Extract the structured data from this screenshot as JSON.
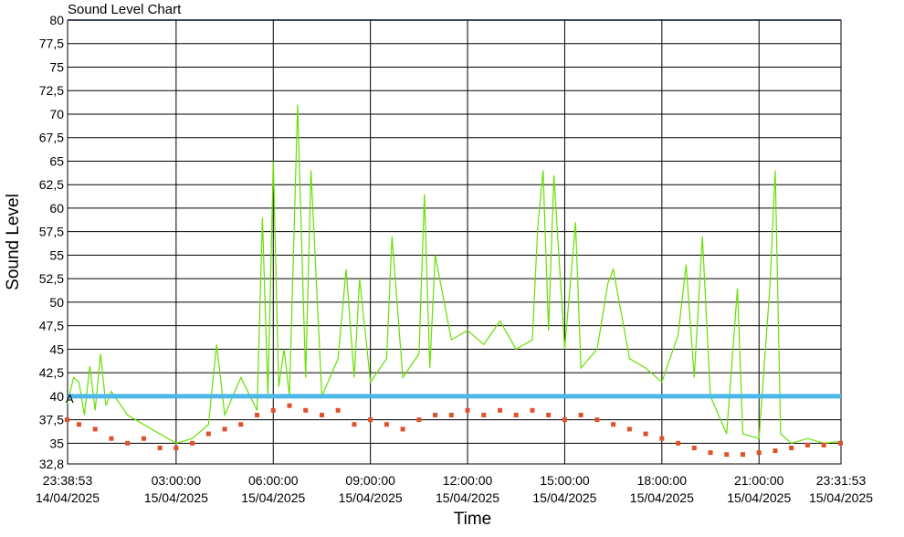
{
  "window": {
    "title": "Sound Level Chart"
  },
  "chart_data": {
    "type": "line",
    "title": "Sound Level Chart",
    "xlabel": "Time",
    "ylabel": "Sound Level",
    "ylim": [
      32.8,
      80
    ],
    "y_ticks": [
      "80",
      "77,5",
      "75",
      "72,5",
      "70",
      "67,5",
      "65",
      "62,5",
      "60",
      "57,5",
      "55",
      "52,5",
      "50",
      "47,5",
      "45",
      "42,5",
      "40",
      "37,5",
      "35",
      "32,8"
    ],
    "x_ticks": [
      {
        "time": "23:38:53",
        "date": "14/04/2025"
      },
      {
        "time": "03:00:00",
        "date": "15/04/2025"
      },
      {
        "time": "06:00:00",
        "date": "15/04/2025"
      },
      {
        "time": "09:00:00",
        "date": "15/04/2025"
      },
      {
        "time": "12:00:00",
        "date": "15/04/2025"
      },
      {
        "time": "15:00:00",
        "date": "15/04/2025"
      },
      {
        "time": "18:00:00",
        "date": "15/04/2025"
      },
      {
        "time": "21:00:00",
        "date": "15/04/2025"
      },
      {
        "time": "23:31:53",
        "date": "15/04/2025"
      }
    ],
    "threshold": {
      "value": 40,
      "color": "#4db8e8",
      "label": "A"
    },
    "series": [
      {
        "style": "line",
        "color": "#66e000",
        "points": [
          [
            "23:38",
            39.2
          ],
          [
            "23:50",
            42.0
          ],
          [
            "00:00",
            41.5
          ],
          [
            "00:10",
            38.0
          ],
          [
            "00:20",
            43.2
          ],
          [
            "00:30",
            38.5
          ],
          [
            "00:40",
            44.5
          ],
          [
            "00:50",
            39.0
          ],
          [
            "01:00",
            40.5
          ],
          [
            "01:30",
            38.0
          ],
          [
            "02:00",
            37.0
          ],
          [
            "02:30",
            36.0
          ],
          [
            "03:00",
            35.0
          ],
          [
            "03:30",
            35.5
          ],
          [
            "04:00",
            37.0
          ],
          [
            "04:15",
            45.5
          ],
          [
            "04:30",
            38.0
          ],
          [
            "05:00",
            42.0
          ],
          [
            "05:30",
            38.5
          ],
          [
            "05:40",
            59.0
          ],
          [
            "05:50",
            40.0
          ],
          [
            "06:00",
            65.0
          ],
          [
            "06:10",
            41.0
          ],
          [
            "06:20",
            45.0
          ],
          [
            "06:30",
            40.0
          ],
          [
            "06:45",
            71.0
          ],
          [
            "07:00",
            42.0
          ],
          [
            "07:10",
            64.0
          ],
          [
            "07:30",
            40.0
          ],
          [
            "08:00",
            44.0
          ],
          [
            "08:15",
            53.5
          ],
          [
            "08:30",
            42.0
          ],
          [
            "08:40",
            52.5
          ],
          [
            "09:00",
            41.5
          ],
          [
            "09:30",
            44.0
          ],
          [
            "09:40",
            57.0
          ],
          [
            "10:00",
            42.0
          ],
          [
            "10:30",
            44.5
          ],
          [
            "10:40",
            61.5
          ],
          [
            "10:50",
            43.0
          ],
          [
            "11:00",
            55.0
          ],
          [
            "11:30",
            46.0
          ],
          [
            "12:00",
            47.0
          ],
          [
            "12:30",
            45.5
          ],
          [
            "13:00",
            48.0
          ],
          [
            "13:30",
            45.0
          ],
          [
            "14:00",
            46.0
          ],
          [
            "14:10",
            58.0
          ],
          [
            "14:20",
            64.0
          ],
          [
            "14:30",
            47.0
          ],
          [
            "14:40",
            63.5
          ],
          [
            "15:00",
            45.0
          ],
          [
            "15:20",
            58.5
          ],
          [
            "15:30",
            43.0
          ],
          [
            "16:00",
            45.0
          ],
          [
            "16:20",
            52.0
          ],
          [
            "16:30",
            53.5
          ],
          [
            "17:00",
            44.0
          ],
          [
            "17:30",
            43.0
          ],
          [
            "18:00",
            41.5
          ],
          [
            "18:30",
            46.5
          ],
          [
            "18:45",
            54.0
          ],
          [
            "19:00",
            42.0
          ],
          [
            "19:15",
            57.0
          ],
          [
            "19:30",
            40.0
          ],
          [
            "20:00",
            36.0
          ],
          [
            "20:20",
            51.5
          ],
          [
            "20:30",
            36.0
          ],
          [
            "21:00",
            35.5
          ],
          [
            "21:20",
            51.5
          ],
          [
            "21:30",
            64.0
          ],
          [
            "21:40",
            36.0
          ],
          [
            "22:00",
            35.0
          ],
          [
            "22:30",
            35.5
          ],
          [
            "23:00",
            35.0
          ],
          [
            "23:31",
            35.2
          ]
        ]
      },
      {
        "style": "markers",
        "color": "#e0502a",
        "points": [
          [
            "23:38",
            37.5
          ],
          [
            "00:00",
            37.0
          ],
          [
            "00:30",
            36.5
          ],
          [
            "01:00",
            35.5
          ],
          [
            "01:30",
            35.0
          ],
          [
            "02:00",
            35.5
          ],
          [
            "02:30",
            34.5
          ],
          [
            "03:00",
            34.5
          ],
          [
            "03:30",
            35.0
          ],
          [
            "04:00",
            36.0
          ],
          [
            "04:30",
            36.5
          ],
          [
            "05:00",
            37.0
          ],
          [
            "05:30",
            38.0
          ],
          [
            "06:00",
            38.5
          ],
          [
            "06:30",
            39.0
          ],
          [
            "07:00",
            38.5
          ],
          [
            "07:30",
            38.0
          ],
          [
            "08:00",
            38.5
          ],
          [
            "08:30",
            37.0
          ],
          [
            "09:00",
            37.5
          ],
          [
            "09:30",
            37.0
          ],
          [
            "10:00",
            36.5
          ],
          [
            "10:30",
            37.5
          ],
          [
            "11:00",
            38.0
          ],
          [
            "11:30",
            38.0
          ],
          [
            "12:00",
            38.5
          ],
          [
            "12:30",
            38.0
          ],
          [
            "13:00",
            38.5
          ],
          [
            "13:30",
            38.0
          ],
          [
            "14:00",
            38.5
          ],
          [
            "14:30",
            38.0
          ],
          [
            "15:00",
            37.5
          ],
          [
            "15:30",
            38.0
          ],
          [
            "16:00",
            37.5
          ],
          [
            "16:30",
            37.0
          ],
          [
            "17:00",
            36.5
          ],
          [
            "17:30",
            36.0
          ],
          [
            "18:00",
            35.5
          ],
          [
            "18:30",
            35.0
          ],
          [
            "19:00",
            34.5
          ],
          [
            "19:30",
            34.0
          ],
          [
            "20:00",
            33.8
          ],
          [
            "20:30",
            33.8
          ],
          [
            "21:00",
            34.0
          ],
          [
            "21:30",
            34.2
          ],
          [
            "22:00",
            34.5
          ],
          [
            "22:30",
            34.8
          ],
          [
            "23:00",
            34.8
          ],
          [
            "23:31",
            35.0
          ]
        ]
      }
    ]
  }
}
